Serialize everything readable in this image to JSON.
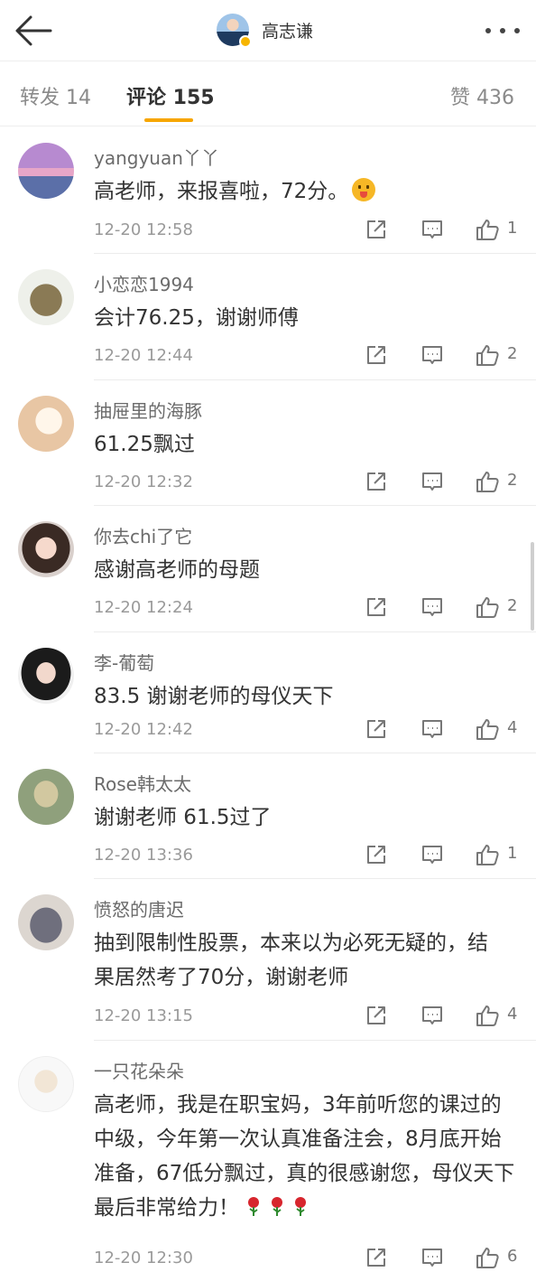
{
  "header": {
    "title": "高志谦"
  },
  "tabs": {
    "repost": "转发 14",
    "comment": "评论 155",
    "like": "赞 436"
  },
  "colors": {
    "accent": "#f7a600",
    "verified": "#f7b500"
  },
  "comments": [
    {
      "name": "yangyuan丫丫",
      "text": "高老师，来报喜啦，72分。",
      "time": "12-20 12:58",
      "likes": "1"
    },
    {
      "name": "小恋恋1994",
      "text": "会计76.25，谢谢师傅",
      "time": "12-20 12:44",
      "likes": "2"
    },
    {
      "name": "抽屉里的海豚",
      "text": "61.25飘过",
      "time": "12-20 12:32",
      "likes": "2"
    },
    {
      "name": "你去chi了它",
      "text": "感谢高老师的母题",
      "time": "12-20 12:24",
      "likes": "2"
    },
    {
      "name": "李-葡萄",
      "text": "83.5 谢谢老师的母仪天下",
      "time": "12-20 12:42",
      "likes": "4"
    },
    {
      "name": "Rose韩太太",
      "text": "谢谢老师 61.5过了",
      "time": "12-20 13:36",
      "likes": "1"
    },
    {
      "name": "愤怒的唐迟",
      "text": "抽到限制性股票，本来以为必死无疑的，结果居然考了70分，谢谢老师",
      "time": "12-20 13:15",
      "likes": "4"
    },
    {
      "name": "一只花朵朵",
      "text": "高老师，我是在职宝妈，3年前听您的课过的中级，今年第一次认真准备注会，8月底开始准备，67低分飘过，真的很感谢您，母仪天下最后非常给力！",
      "time": "12-20 12:30",
      "likes": "6"
    }
  ]
}
